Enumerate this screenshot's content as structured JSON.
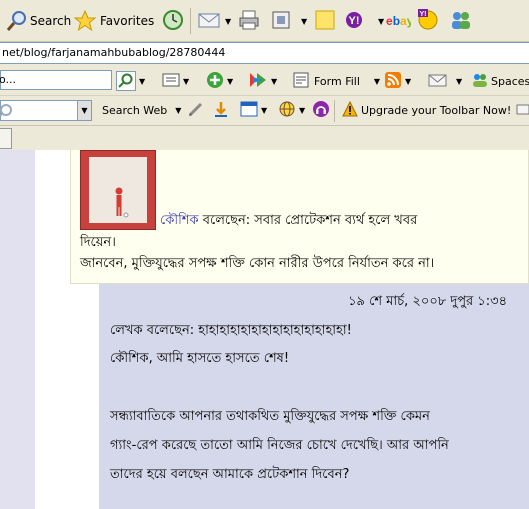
{
  "toolbar_main": {
    "search_label": "Search",
    "favorites_label": "Favorites"
  },
  "address_bar": {
    "url": "net/blog/farjanamahbubablog/28780444"
  },
  "toolbar_links": {
    "form_fill_label": "Form Fill",
    "spaces_label": "Spaces"
  },
  "toolbar_search": {
    "search_web_label": "Search Web",
    "upgrade_label": "Upgrade your Toolbar Now!"
  },
  "comments": [
    {
      "author": "কৌশিক",
      "line1_rest": " বলেছেন: সবার প্রোটেকশন ব্যর্থ হলে খবর",
      "line2": "দিয়েন।",
      "line3": "জানবেন, মুক্তিযুদ্ধের সপক্ষ শক্তি কোন নারীর উপরে নির্যাতন করে না।"
    },
    {
      "timestamp": "১৯ শে মার্চ, ২০০৮ দুপুর ১:৩৪",
      "line1": "লেখক বলেছেন: হাহাহাহাহাহাহাহাহাহাহাহাহাহা!",
      "line2": "কৌশিক, আমি হাসতে হাসতে শেষ!",
      "line3": "সন্ধ্যাবাতিকে আপনার তথাকথিত মুক্তিযুদ্ধের সপক্ষ শক্তি কেমন",
      "line4": "গ্যাং-রেপ করেছে তাতো আমি নিজের চোখে দেখেছি। আর আপনি",
      "line5": "তাদের হয়ে বলছেন আমাকে প্রটেকশান দিবেন?"
    }
  ],
  "colors": {
    "author_link": "#3333aa",
    "comment1_bg": "#ffffef",
    "comment2_bg": "#d5d7ea",
    "chrome_bg": "#ece9d8"
  }
}
